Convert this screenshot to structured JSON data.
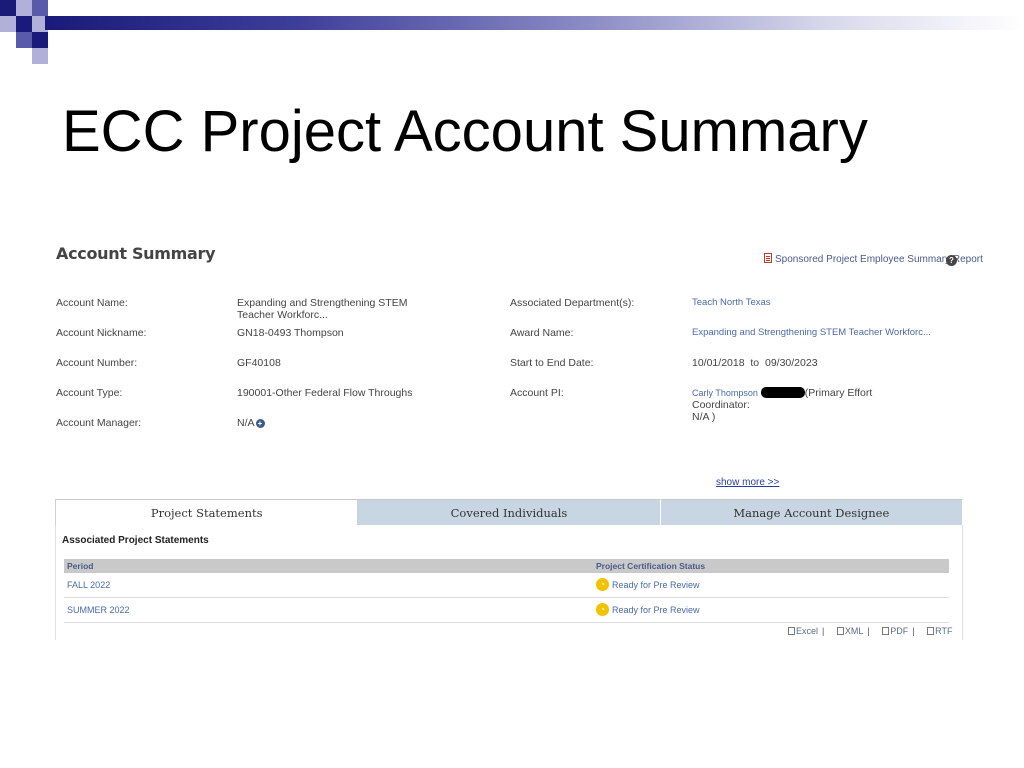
{
  "slide": {
    "title": "ECC Project Account Summary",
    "deco_colors": {
      "dark": "#1a1a7a",
      "mid": "#5a5aaa",
      "light": "#b0b0d8"
    }
  },
  "account_summary": {
    "heading": "Account Summary",
    "report_link": "Sponsored Project Employee Summary Report",
    "help_icon": "question-circle-icon",
    "fields_left": [
      {
        "label": "Account Name:",
        "value": "Expanding and Strengthening STEM Teacher Workforc..."
      },
      {
        "label": "Account Nickname:",
        "value": "GN18-0493 Thompson"
      },
      {
        "label": "Account Number:",
        "value": "GF40108"
      },
      {
        "label": "Account Type:",
        "value": "190001-Other Federal Flow Throughs"
      },
      {
        "label": "Account Manager:",
        "value": "N/A"
      }
    ],
    "fields_right": [
      {
        "label": "Associated Department(s):",
        "value": "Teach North Texas"
      },
      {
        "label": "Award Name:",
        "value": "Expanding and Strengthening STEM Teacher Workforc..."
      },
      {
        "label": "Start to End Date:",
        "value": "10/01/2018  to  09/30/2023"
      },
      {
        "label": "Account PI:",
        "value_name": "Carly Thompson",
        "value_rest": "(Primary Effort Coordinator:",
        "value_rest2": "N/A )"
      }
    ],
    "show_more": "show more >>"
  },
  "tabs": [
    {
      "label": "Project Statements",
      "active": true
    },
    {
      "label": "Covered Individuals",
      "active": false
    },
    {
      "label": "Manage Account Designee",
      "active": false
    }
  ],
  "project_statements": {
    "heading": "Associated Project Statements",
    "columns": [
      "Period",
      "Project Certification Status"
    ],
    "rows": [
      {
        "period": "FALL 2022",
        "status": "Ready for Pre Review"
      },
      {
        "period": "SUMMER 2022",
        "status": "Ready for Pre Review"
      }
    ],
    "exports": [
      "Excel",
      "XML",
      "PDF",
      "RTF"
    ]
  }
}
